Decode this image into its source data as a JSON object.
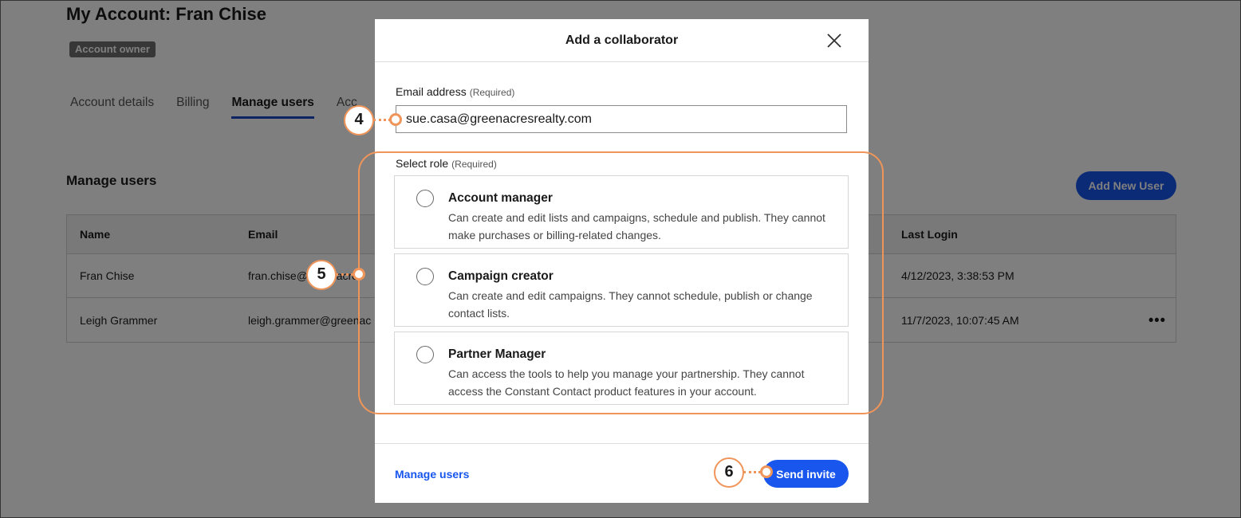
{
  "page": {
    "title": "My Account: Fran Chise",
    "badge": "Account owner",
    "tabs": [
      "Account details",
      "Billing",
      "Manage users",
      "Acc"
    ],
    "section_title": "Manage users",
    "add_user_label": "Add New User"
  },
  "table": {
    "headers": {
      "name": "Name",
      "email": "Email",
      "last_login": "Last Login"
    },
    "rows": [
      {
        "name": "Fran Chise",
        "email": "fran.chise@greenacres",
        "last_login": "4/12/2023, 3:38:53 PM"
      },
      {
        "name": "Leigh Grammer",
        "email": "leigh.grammer@greenac",
        "last_login": "11/7/2023, 10:07:45 AM",
        "more": "•••"
      }
    ]
  },
  "modal": {
    "title": "Add a collaborator",
    "email_label": "Email address",
    "required_text": "(Required)",
    "email_value": "sue.casa@greenacresrealty.com",
    "role_label": "Select role",
    "roles": [
      {
        "title": "Account manager",
        "desc": "Can create and edit lists and campaigns, schedule and publish. They cannot make purchases or billing-related changes."
      },
      {
        "title": "Campaign creator",
        "desc": "Can create and edit campaigns. They cannot schedule, publish or change contact lists."
      },
      {
        "title": "Partner Manager",
        "desc": "Can access the tools to help you manage your partnership. They cannot access the Constant Contact product features in your account."
      }
    ],
    "footer_link": "Manage users",
    "send_label": "Send invite"
  },
  "annotations": {
    "step4": "4",
    "step5": "5",
    "step6": "6"
  },
  "colors": {
    "primary": "#1856ed",
    "tab_underline": "#1a47c4",
    "callout": "#f0955a"
  }
}
